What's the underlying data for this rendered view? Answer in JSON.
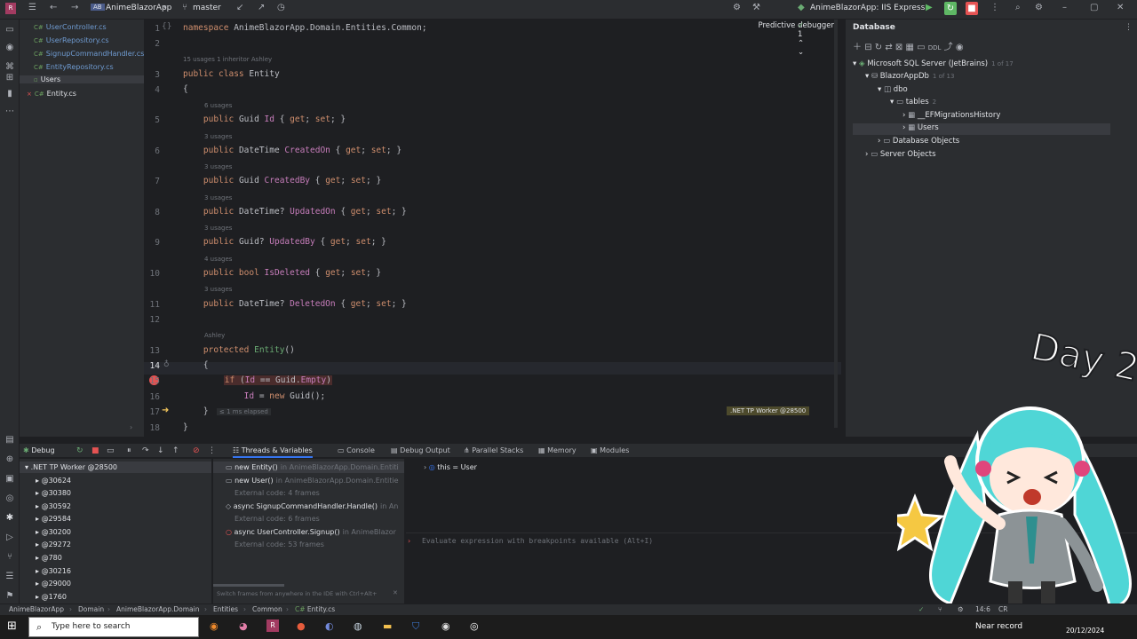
{
  "titlebar": {
    "project": "AnimeBlazorApp",
    "branch": "master",
    "predictive": "Predictive debugger",
    "run_config": "AnimeBlazorApp: IIS Express",
    "inspections": "1"
  },
  "project_files": [
    {
      "label": "UserController.cs"
    },
    {
      "label": "UserRepository.cs"
    },
    {
      "label": "SignupCommandHandler.cs"
    },
    {
      "label": "EntityRepository.cs"
    },
    {
      "label": "Users"
    },
    {
      "label": "Entity.cs"
    }
  ],
  "code_lines": [
    {
      "n": "1",
      "text": "namespace AnimeBlazorApp.Domain.Entities.Common;"
    },
    {
      "n": "2",
      "text": ""
    },
    {
      "n": "3",
      "text": "public class Entity",
      "hint": "15 usages   1 inheritor   Ashley"
    },
    {
      "n": "4",
      "text": "{"
    },
    {
      "n": "5",
      "text": "    public Guid Id { get; set; }",
      "hint": "6 usages"
    },
    {
      "n": "6",
      "text": "    public DateTime CreatedOn { get; set; }",
      "hint": "3 usages"
    },
    {
      "n": "7",
      "text": "    public Guid CreatedBy { get; set; }",
      "hint": "3 usages"
    },
    {
      "n": "8",
      "text": "    public DateTime? UpdatedOn { get; set; }",
      "hint": "3 usages"
    },
    {
      "n": "9",
      "text": "    public Guid? UpdatedBy { get; set; }",
      "hint": "3 usages"
    },
    {
      "n": "10",
      "text": "    public bool IsDeleted { get; set; }",
      "hint": "4 usages"
    },
    {
      "n": "11",
      "text": "    public DateTime? DeletedOn { get; set; }",
      "hint": "3 usages"
    },
    {
      "n": "12",
      "text": ""
    },
    {
      "n": "13",
      "text": "    protected Entity()",
      "hint": "Ashley"
    },
    {
      "n": "14",
      "text": "    {"
    },
    {
      "n": "15",
      "text": "        if (Id == Guid.Empty)"
    },
    {
      "n": "16",
      "text": "            Id = new Guid();"
    },
    {
      "n": "17",
      "text": "    }"
    },
    {
      "n": "18",
      "text": "}"
    }
  ],
  "elapsed": "≤ 1 ms elapsed",
  "thread_badge": ".NET TP Worker @28500",
  "database": {
    "title": "Database",
    "nodes": [
      {
        "label": "Microsoft SQL Server (JetBrains)",
        "meta": "1 of 17"
      },
      {
        "label": "BlazorAppDb",
        "meta": "1 of 13"
      },
      {
        "label": "dbo",
        "meta": ""
      },
      {
        "label": "tables",
        "meta": "2"
      },
      {
        "label": "__EFMigrationsHistory",
        "meta": ""
      },
      {
        "label": "Users",
        "meta": ""
      },
      {
        "label": "Database Objects",
        "meta": ""
      },
      {
        "label": "Server Objects",
        "meta": ""
      }
    ]
  },
  "overlay_text": "Day 2",
  "debug": {
    "title": "Debug",
    "tabs": [
      "Threads & Variables",
      "Console",
      "Debug Output",
      "Parallel Stacks",
      "Memory",
      "Modules"
    ],
    "threads": [
      ".NET TP Worker @28500",
      "@30624",
      "@30380",
      "@30592",
      "@29584",
      "@30200",
      "@29272",
      "@780",
      "@30216",
      "@29000",
      "@1760"
    ],
    "frames": [
      {
        "name": "new Entity()",
        "loc": "in AnimeBlazorApp.Domain.Entiti"
      },
      {
        "name": "new User()",
        "loc": "in AnimeBlazorApp.Domain.Entitie"
      },
      {
        "name": "External code: 4 frames",
        "loc": ""
      },
      {
        "name": "async SignupCommandHandler.Handle()",
        "loc": "in An"
      },
      {
        "name": "External code: 6 frames",
        "loc": ""
      },
      {
        "name": "async UserController.Signup()",
        "loc": "in AnimeBlazor"
      },
      {
        "name": "External code: 53 frames",
        "loc": ""
      }
    ],
    "frames_hint": "Switch frames from anywhere in the IDE with Ctrl+Alt+",
    "var_this": "this = User",
    "eval_placeholder": "Evaluate expression with breakpoints available (Alt+I)"
  },
  "breadcrumb": [
    "AnimeBlazorApp",
    "Domain",
    "AnimeBlazorApp.Domain",
    "Entities",
    "Common",
    "Entity.cs"
  ],
  "status": {
    "position": "14:6",
    "encoding": "CR"
  },
  "taskbar": {
    "search_placeholder": "Type here to search",
    "weather": "Near record",
    "date": "20/12/2024"
  },
  "colors": {
    "accent": "#3574f0",
    "run_green": "#5fb865",
    "stop_red": "#e55353",
    "miku": "#4fd6d6"
  }
}
